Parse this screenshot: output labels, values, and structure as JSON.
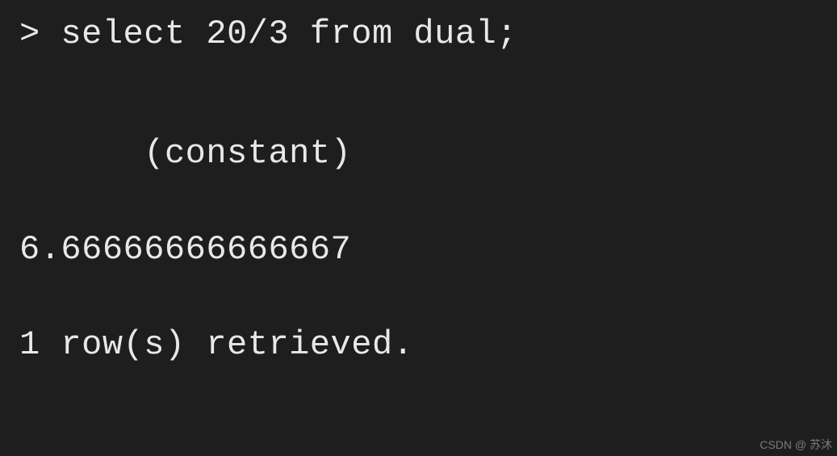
{
  "terminal": {
    "prompt": ">",
    "query": "select 20/3 from dual;",
    "column_header": "(constant)",
    "result_value": "6.66666666666667",
    "status": "1 row(s) retrieved."
  },
  "watermark": "CSDN @ 苏沐"
}
